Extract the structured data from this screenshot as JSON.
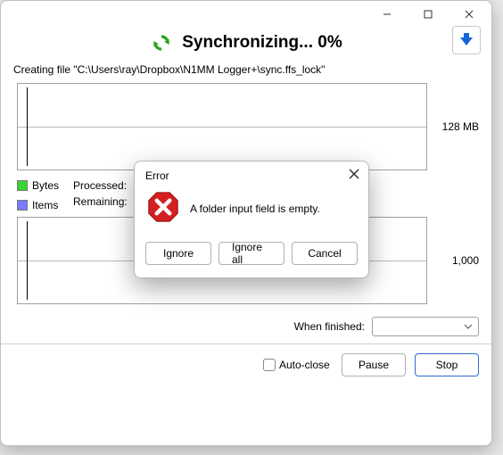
{
  "title": "Synchronizing... 0%",
  "status_line": "Creating file \"C:\\Users\\ray\\Dropbox\\N1MM Logger+\\sync.ffs_lock\"",
  "chart1_label": "128 MB",
  "chart2_label": "1,000",
  "legend": {
    "bytes": "Bytes",
    "items": "Items"
  },
  "stats": {
    "processed_label": "Processed:",
    "remaining_label": "Remaining:"
  },
  "when_finished_label": "When finished:",
  "footer": {
    "autoclose_label": "Auto-close",
    "pause_label": "Pause",
    "stop_label": "Stop"
  },
  "error": {
    "title": "Error",
    "message": "A folder input field is empty.",
    "ignore": "Ignore",
    "ignore_all": "Ignore all",
    "cancel": "Cancel"
  }
}
